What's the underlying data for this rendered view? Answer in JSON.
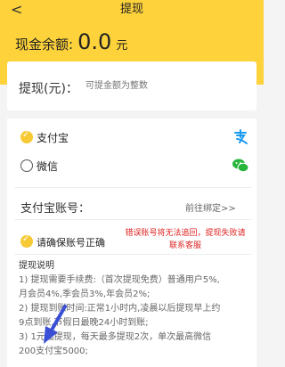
{
  "header": {
    "title": "提现",
    "back_glyph": "<"
  },
  "balance": {
    "label": "现金余额:",
    "value": "0.0",
    "unit": "元"
  },
  "amount": {
    "label": "提现(元)：",
    "placeholder": "可提金额为整数"
  },
  "methods": [
    {
      "label": "支付宝",
      "selected": true,
      "icon": "alipay-icon",
      "color": "#1a9bf1"
    },
    {
      "label": "微信",
      "selected": false,
      "icon": "wechat-icon",
      "color": "#27b53c"
    }
  ],
  "account": {
    "label": "支付宝账号：",
    "link": "前往绑定>>"
  },
  "confirm": {
    "label": "请确保账号正确"
  },
  "warning": {
    "line1": "错误账号将无法追回，提现失败请",
    "line2": "联系客服"
  },
  "notes": {
    "heading": "提现说明",
    "lines": [
      "1) 提现需要手续费:（首次提现免费）普通用户5%,",
      "月会员4%,季会员3%,年会员2%;",
      "2) 提现到账时间:正常1小时内,凌晨以后提现早上约",
      "9点到账,节假日最晚24小时到账;",
      "3) 1元起提现，每天最多提现2次，单次最高微信",
      "200支付宝5000;"
    ]
  },
  "colors": {
    "header_bg": "#fdd23a",
    "accent": "#f7c934",
    "warning": "#dd2222",
    "arrow": "#3a4fd6"
  }
}
